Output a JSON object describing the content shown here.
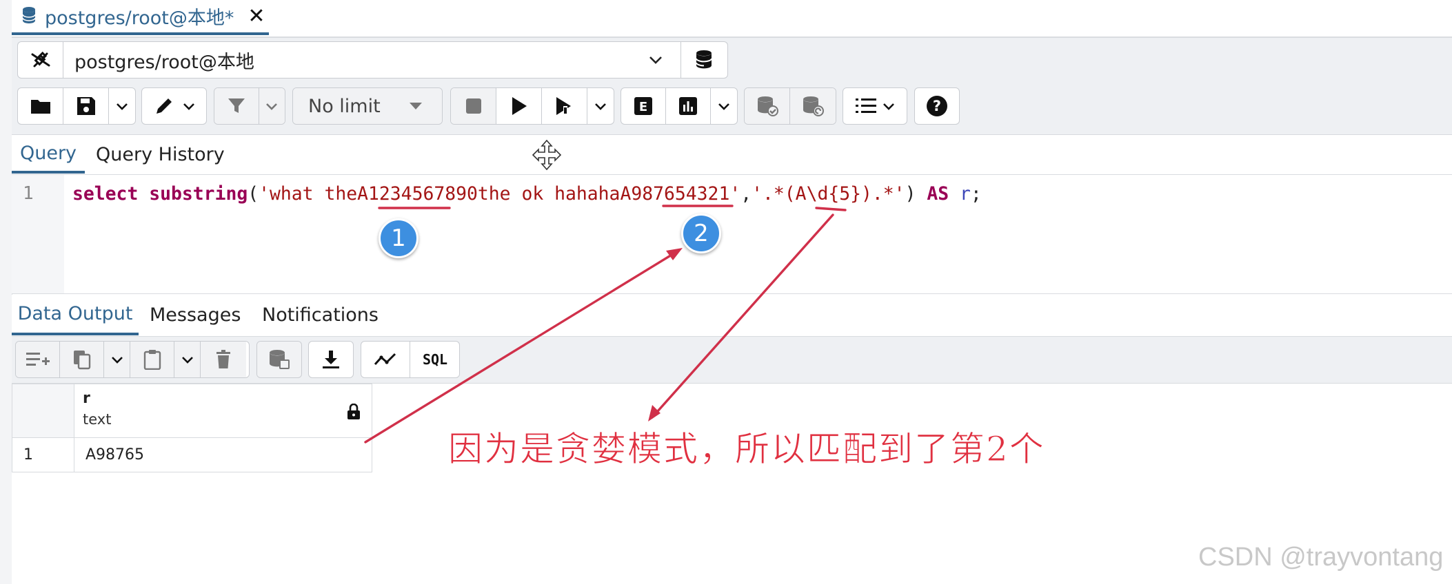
{
  "tab": {
    "title": "postgres/root@本地*",
    "close_symbol": "✕"
  },
  "connection": {
    "selected": "postgres/root@本地"
  },
  "toolbar": {
    "limit_label": "No limit"
  },
  "query_tabs": [
    {
      "label": "Query"
    },
    {
      "label": "Query History"
    }
  ],
  "editor": {
    "line_number": "1",
    "segments": {
      "kw1": "select",
      "sp1": " ",
      "kw2": "substring",
      "p1": "(",
      "str1": "'what theA1234567890the ok hahahaA987654321'",
      "comma": ",",
      "str2": "'.*(A\\d{5}).*'",
      "p2": ")",
      "sp2": " ",
      "kw3": "AS",
      "sp3": " ",
      "var": "r",
      "semi": ";"
    }
  },
  "output_tabs": [
    {
      "label": "Data Output"
    },
    {
      "label": "Messages"
    },
    {
      "label": "Notifications"
    }
  ],
  "grid": {
    "columns": [
      {
        "name": "r",
        "type": "text"
      }
    ],
    "rows": [
      {
        "num": "1",
        "values": [
          "A98765"
        ]
      }
    ]
  },
  "annotations": {
    "badge1": "1",
    "badge2": "2",
    "caption": "因为是贪婪模式，所以匹配到了第2个",
    "color": "#d0304a"
  },
  "watermark": "CSDN @trayvontang",
  "colors": {
    "accent": "#326690",
    "keyword": "#990055",
    "string": "#a31515"
  }
}
